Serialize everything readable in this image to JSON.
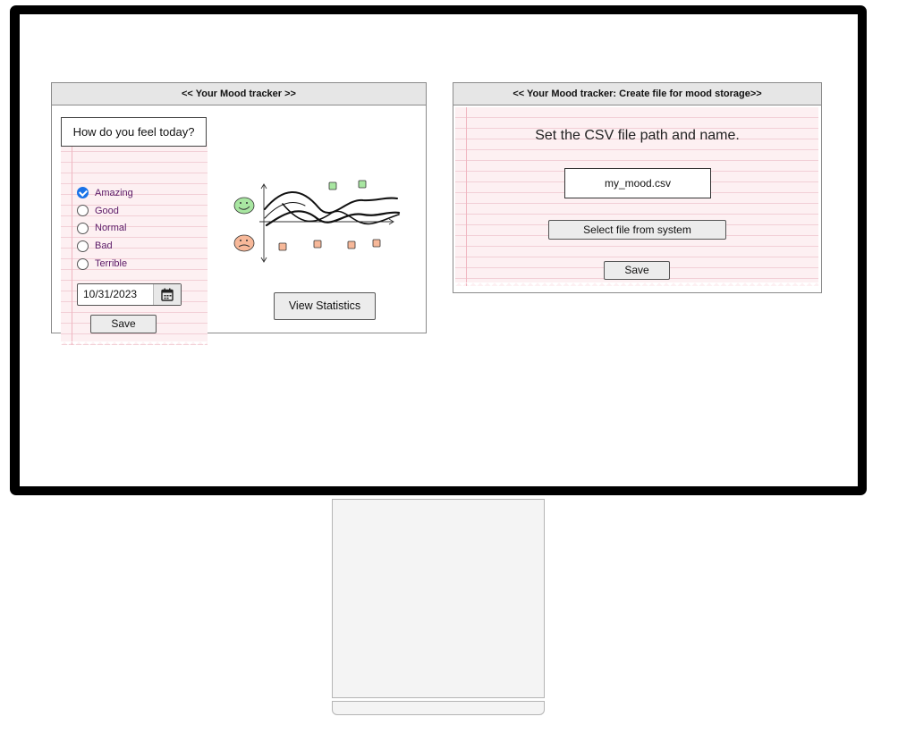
{
  "left_window": {
    "title": "<< Your Mood tracker >>",
    "question": "How do you feel today?",
    "moods": [
      {
        "label": "Amazing",
        "checked": true
      },
      {
        "label": "Good",
        "checked": false
      },
      {
        "label": "Normal",
        "checked": false
      },
      {
        "label": "Bad",
        "checked": false
      },
      {
        "label": "Terrible",
        "checked": false
      }
    ],
    "date_value": "10/31/2023",
    "save_label": "Save",
    "view_statistics_label": "View Statistics"
  },
  "right_window": {
    "title": "<< Your Mood tracker: Create file for mood storage>>",
    "instruction": "Set the CSV file path and name.",
    "file_name_value": "my_mood.csv",
    "select_file_label": "Select file from system",
    "save_label": "Save"
  },
  "colors": {
    "accent": "#1a73e8",
    "paper": "#fdf0f2",
    "radio_text": "#5b1a67",
    "happy_marker": "#a8e6a1",
    "sad_marker": "#f7b899"
  }
}
